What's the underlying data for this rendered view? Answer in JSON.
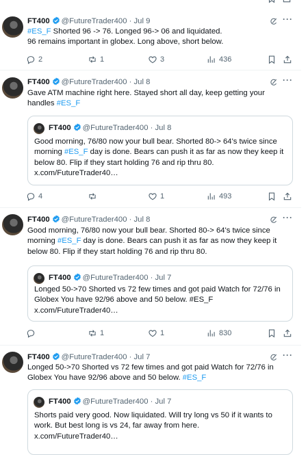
{
  "tweets": [
    {
      "name": "FT400",
      "handle": "@FutureTrader400",
      "date": "· Jul 9",
      "tag1": "#ES_F",
      "text_after_tag": " Shorted 96 -> 76. Longed 96-> 06 and liquidated.",
      "text_line2": "96 remains important in globex. Long above, short below.",
      "replies": "2",
      "reposts": "1",
      "likes": "3",
      "views": "436"
    },
    {
      "name": "FT400",
      "handle": "@FutureTrader400",
      "date": "· Jul 8",
      "text": "Gave ATM machine right here.  Stayed short all day,  keep getting your handles ",
      "tag": "#ES_F",
      "quote": {
        "name": "FT400",
        "handle": "@FutureTrader400",
        "date": "· Jul 8",
        "text_a": "Good morning,  76/80 now your bull bear. Shorted 80-> 64's twice since morning ",
        "tag": "#ES_F",
        "text_b": " day is done.  Bears can push it as far as now they keep it below 80. Flip if they start holding 76 and rip thru 80.",
        "link": "x.com/FutureTrader40…"
      },
      "replies": "4",
      "reposts": "",
      "likes": "1",
      "views": "493"
    },
    {
      "name": "FT400",
      "handle": "@FutureTrader400",
      "date": "· Jul 8",
      "text_a": "Good morning,  76/80 now your bull bear. Shorted 80-> 64's twice since morning ",
      "tag": "#ES_F",
      "text_b": " day is done.  Bears can push it as far as now they keep it below 80. Flip if they start holding 76 and rip thru 80.",
      "quote": {
        "name": "FT400",
        "handle": "@FutureTrader400",
        "date": "· Jul 7",
        "text": "Longed 50->70 Shorted vs 72 few times and got paid Watch for 72/76 in Globex You have 92/96 above and 50 below. #ES_F",
        "link": "x.com/FutureTrader40…"
      },
      "replies": "",
      "reposts": "1",
      "likes": "1",
      "views": "830"
    },
    {
      "name": "FT400",
      "handle": "@FutureTrader400",
      "date": "· Jul 7",
      "text": "Longed 50->70 Shorted vs 72 few times and got paid Watch for 72/76 in Globex You have 92/96 above and 50 below. ",
      "tag": "#ES_F",
      "quote": {
        "name": "FT400",
        "handle": "@FutureTrader400",
        "date": "· Jul 7",
        "text": "Shorts paid very good. Now liquidated. Will try long vs 50 if it wants to work. But best long is vs 24, far away from here.",
        "link": "x.com/FutureTrader40…"
      }
    }
  ],
  "colors": {
    "accent": "#1d9bf0",
    "muted": "#536471",
    "border": "#cfd9de"
  }
}
